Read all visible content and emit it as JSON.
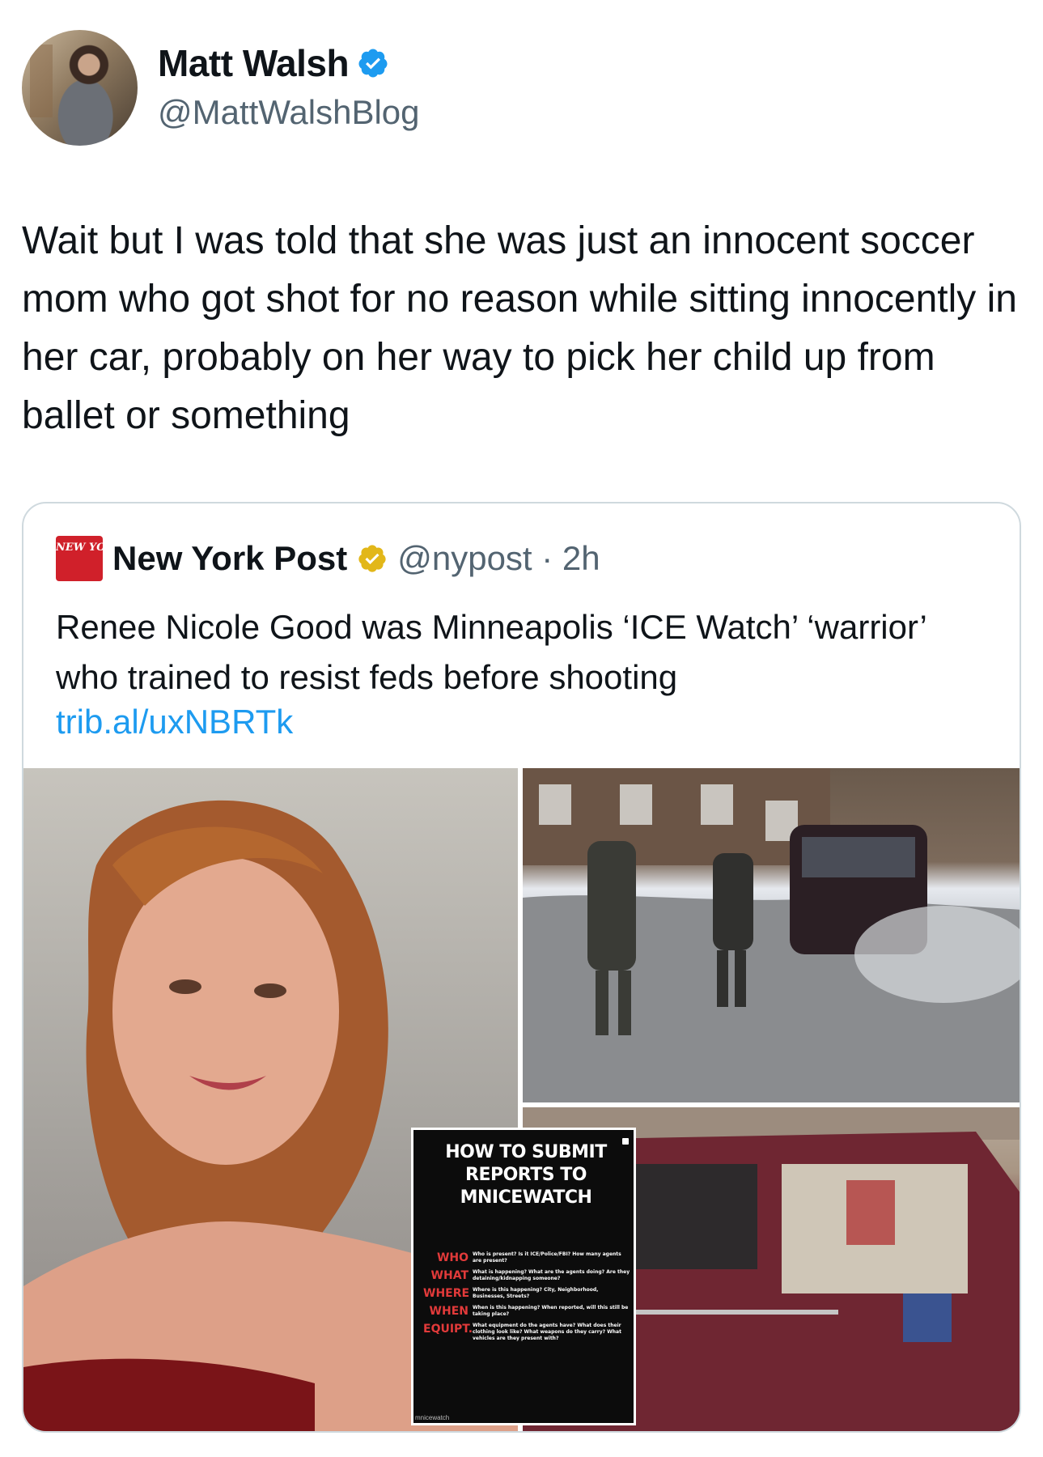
{
  "tweet": {
    "display_name": "Matt Walsh",
    "handle": "@MattWalshBlog",
    "verified_icon": "verified-badge-blue",
    "text": "Wait but I was told that she was just an innocent soccer mom who got shot for no reason while sitting innocently in her car, probably on her way to pick her child up from ballet or something"
  },
  "quoted": {
    "logo_text": "NEW YORK POST",
    "display_name": "New York Post",
    "verified_icon": "verified-badge-gold",
    "handle_time": "@nypost · 2h",
    "text": "Renee Nicole Good was Minneapolis ‘ICE Watch’ ‘warrior’ who trained to resist feds before shooting",
    "link": "trib.al/uxNBRTk",
    "poster": {
      "title": "HOW TO SUBMIT REPORTS TO MNICEWATCH",
      "rows": [
        {
          "label": "WHO",
          "desc": "Who is present? Is it ICE/Police/FBI? How many agents are present?"
        },
        {
          "label": "WHAT",
          "desc": "What is happening? What are the agents doing? Are they detaining/kidnapping someone?"
        },
        {
          "label": "WHERE",
          "desc": "Where is this happening? City, Neighborhood, Businesses, Streets?"
        },
        {
          "label": "WHEN",
          "desc": "When is this happening? When reported, will this still be taking place?"
        },
        {
          "label": "EQUIPT.",
          "desc": "What equipment do the agents have? What does their clothing look like? What weapons do they carry? What vehicles are they present with?"
        }
      ],
      "footer": "mnicewatch"
    }
  },
  "colors": {
    "link_blue": "#1d9bf0",
    "secondary_gray": "#536471",
    "border": "#cfd9de",
    "nyp_red": "#d0202a",
    "verified_gold": "#e2b719"
  }
}
